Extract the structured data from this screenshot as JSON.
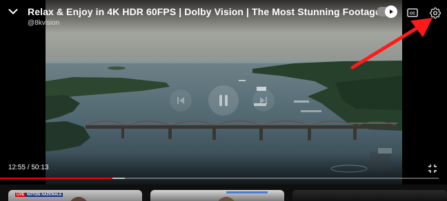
{
  "player": {
    "title": "Relax & Enjoy in 4K HDR 60FPS | Dolby Vision | The Most Stunning Footage",
    "channel": "@8kvision",
    "current_time": "12:55",
    "duration": "50:13",
    "time_separator": " / ",
    "progress_fraction": 0.257,
    "buffered_fraction": 0.285,
    "autoplay_on": true,
    "progress_color": "#ff0000"
  },
  "controls": {
    "collapse_icon": "chevron-down-icon",
    "autoplay_icon": "play-icon",
    "cc_icon": "closed-captions-icon",
    "settings_icon": "gear-icon",
    "prev_icon": "skip-previous-icon",
    "pause_icon": "pause-icon",
    "next_icon": "skip-next-icon",
    "fullscreen_icon": "exit-fullscreen-icon"
  },
  "related": [
    {
      "badge_live": "LIVE",
      "badge_network": "NOTIZIE NAZIONALE"
    },
    {
      "badge_live": "",
      "badge_network": ""
    },
    {
      "badge_live": "",
      "badge_network": ""
    }
  ],
  "annotation_color": "#ff1a1a"
}
